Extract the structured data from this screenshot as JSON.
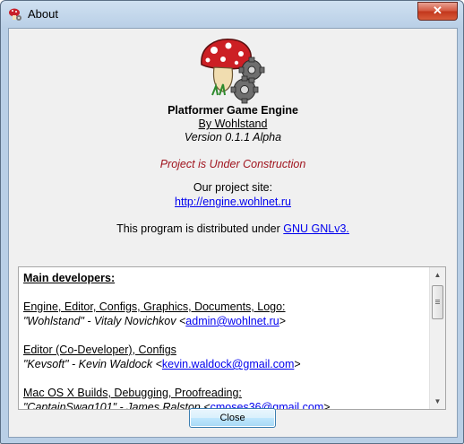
{
  "window": {
    "title": "About",
    "close_glyph": "✕"
  },
  "about": {
    "product_name": "Platformer Game Engine",
    "author_link": "By Wohlstand",
    "version": "Version 0.1.1 Alpha",
    "status": "Project is Under Construction",
    "site_label": "Our project site:",
    "site_url": "http://engine.wohlnet.ru",
    "license_prefix": "This program is distributed under ",
    "license_link": "GNU GNLv3."
  },
  "credits": {
    "heading": "Main developers:",
    "entries": [
      {
        "role": "Engine, Editor, Configs, Graphics, Documents, Logo:",
        "person": "\"Wohlstand\" - Vitaly Novichkov <",
        "email": "admin@wohlnet.ru",
        "suffix": ">"
      },
      {
        "role": "Editor (Co-Developer), Configs",
        "person": "\"Kevsoft\" - Kevin Waldock <",
        "email": "kevin.waldock@gmail.com",
        "suffix": ">"
      },
      {
        "role": "Mac OS X Builds, Debugging, Proofreading:",
        "person": "\"CaptainSwag101\" - James Ralston <",
        "email": "cmoses36@gmail.com",
        "suffix": ">"
      }
    ]
  },
  "buttons": {
    "close": "Close"
  },
  "icons": {
    "app": "mushroom-gear-icon",
    "logo": "mushroom-gears-logo",
    "scroll_up": "scroll-up-arrow-icon",
    "scroll_down": "scroll-down-arrow-icon"
  },
  "colors": {
    "status_red": "#a0141e",
    "link_blue": "#0000ee"
  }
}
